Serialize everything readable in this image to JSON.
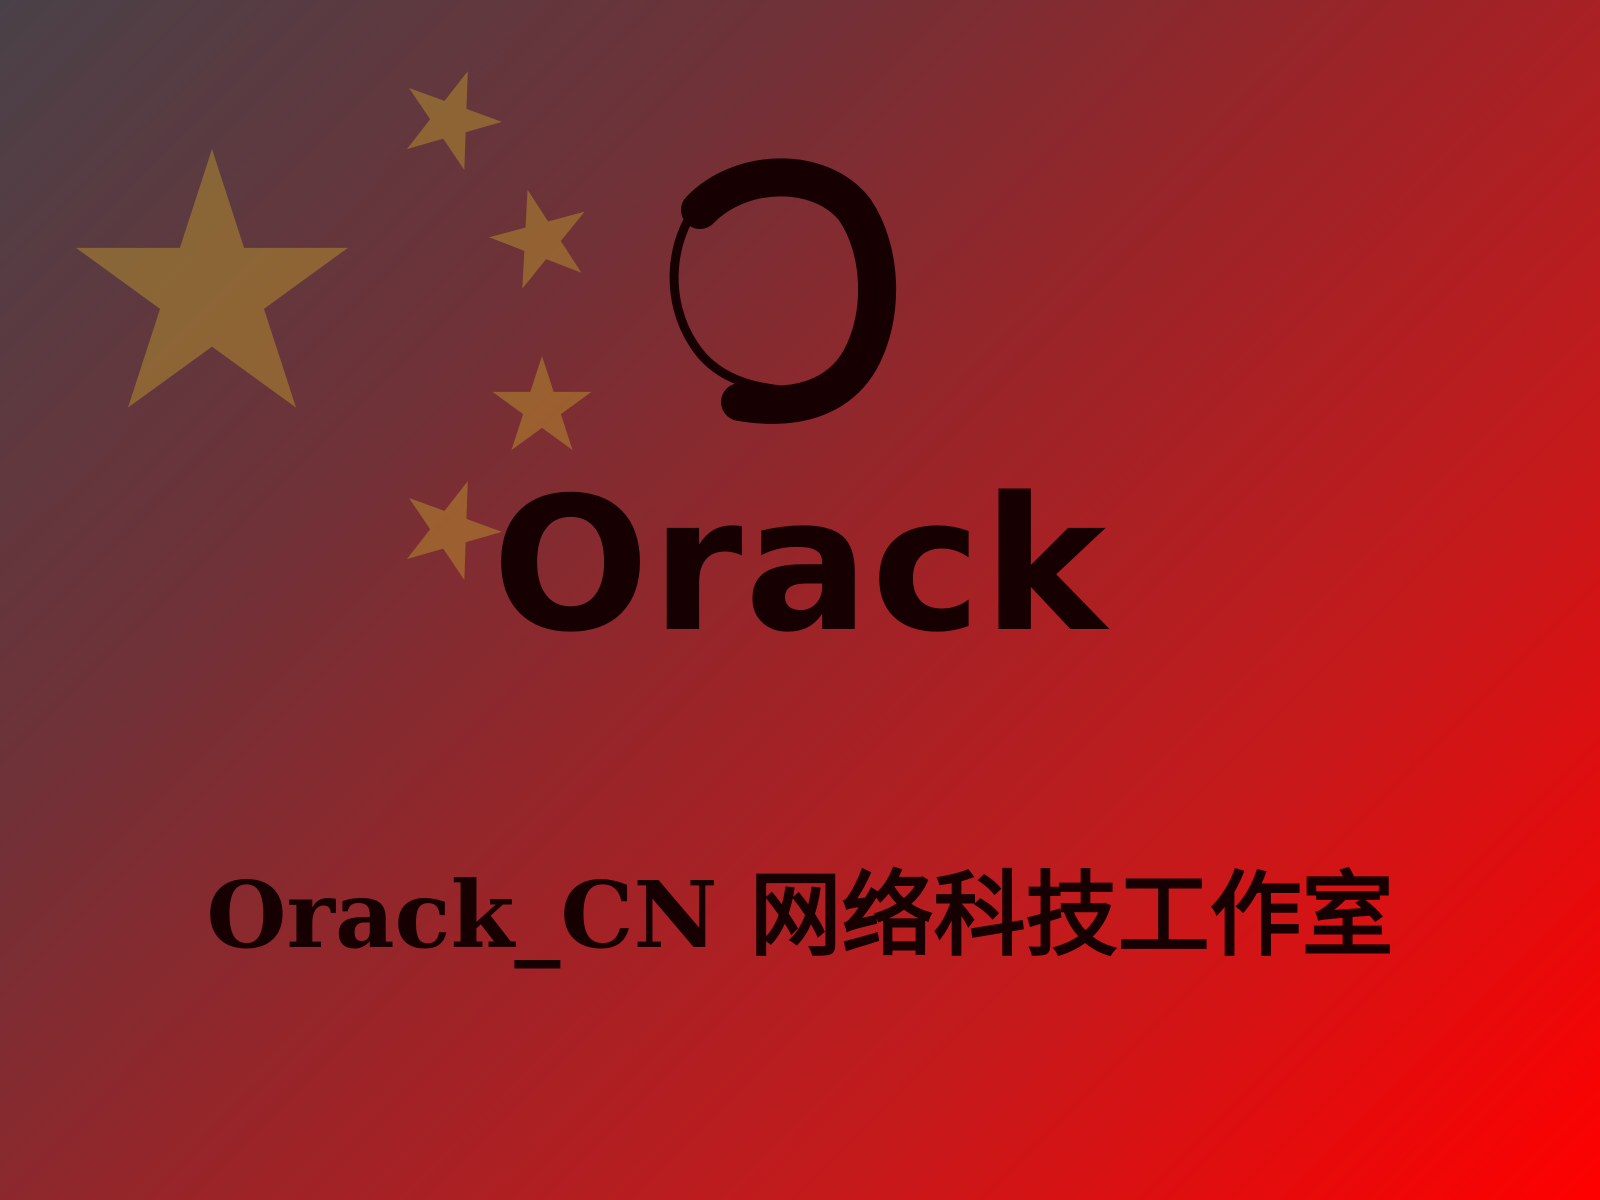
{
  "brand": {
    "wordmark": "Orack",
    "tagline": "Orack_CN 网络科技工作室"
  },
  "colors": {
    "ink": "#160002",
    "star": "#c8a52a",
    "background_start": "#4a4148",
    "background_end": "#ff0000"
  },
  "icons": {
    "logo": "brush-circle-o-logo",
    "stars": "flag-stars"
  }
}
